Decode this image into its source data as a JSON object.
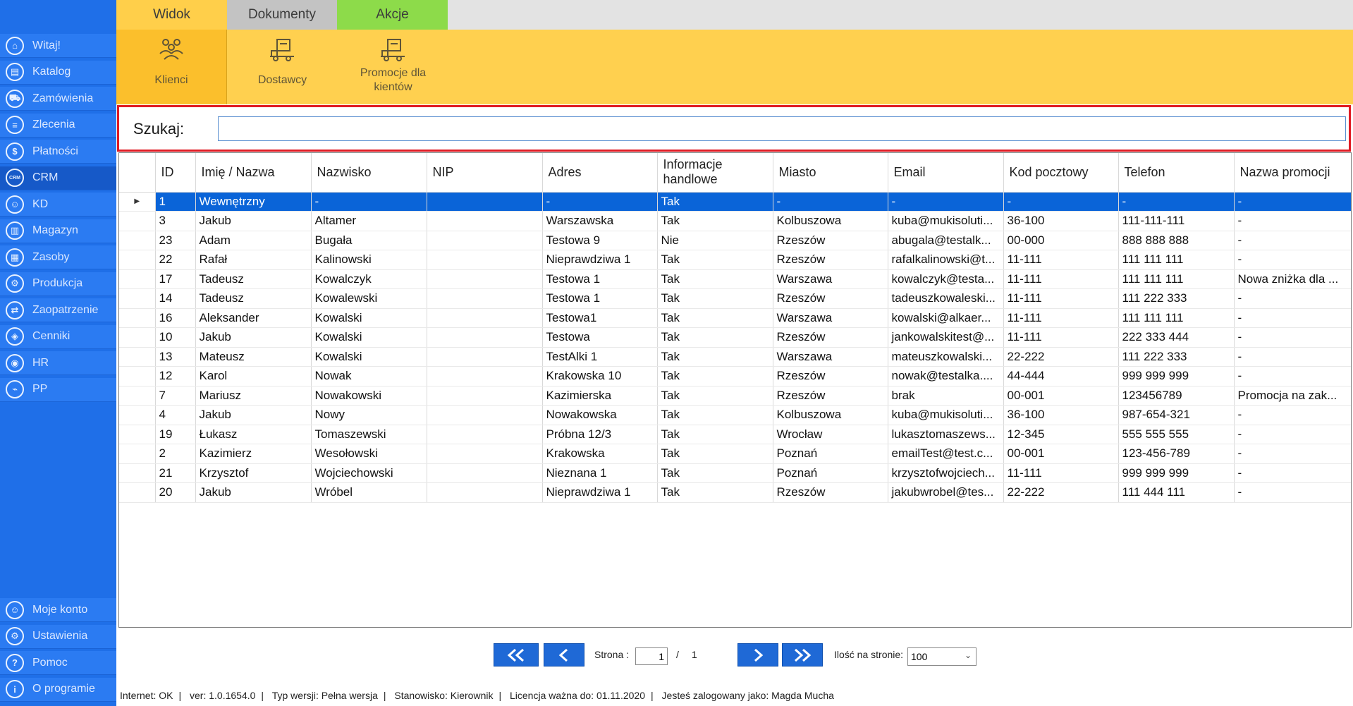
{
  "tabs": [
    "Widok",
    "Dokumenty",
    "Akcje"
  ],
  "ribbon": {
    "klienci": "Klienci",
    "dostawcy": "Dostawcy",
    "promocje_line1": "Promocje dla",
    "promocje_line2": "kientów"
  },
  "sidebar": {
    "items": [
      {
        "label": "Witaj!",
        "icon": "home-icon"
      },
      {
        "label": "Katalog",
        "icon": "book-icon"
      },
      {
        "label": "Zamówienia",
        "icon": "cart-icon"
      },
      {
        "label": "Zlecenia",
        "icon": "list-icon"
      },
      {
        "label": "Płatności",
        "icon": "dollar-icon"
      },
      {
        "label": "CRM",
        "icon": "crm-icon"
      },
      {
        "label": "KD",
        "icon": "person-icon"
      },
      {
        "label": "Magazyn",
        "icon": "warehouse-icon"
      },
      {
        "label": "Zasoby",
        "icon": "resources-icon"
      },
      {
        "label": "Produkcja",
        "icon": "production-icon"
      },
      {
        "label": "Zaopatrzenie",
        "icon": "truck-icon"
      },
      {
        "label": "Cenniki",
        "icon": "tag-icon"
      },
      {
        "label": "HR",
        "icon": "hr-icon"
      },
      {
        "label": "PP",
        "icon": "pp-icon"
      }
    ],
    "bottom": [
      {
        "label": "Moje konto",
        "icon": "account-icon"
      },
      {
        "label": "Ustawienia",
        "icon": "settings-icon"
      },
      {
        "label": "Pomoc",
        "icon": "help-icon"
      },
      {
        "label": "O programie",
        "icon": "info-icon"
      }
    ]
  },
  "search": {
    "label": "Szukaj:",
    "value": ""
  },
  "grid": {
    "columns": [
      "ID",
      "Imię / Nazwa",
      "Nazwisko",
      "NIP",
      "Adres",
      "Informacje handlowe",
      "Miasto",
      "Email",
      "Kod pocztowy",
      "Telefon",
      "Nazwa promocji"
    ],
    "rows": [
      [
        "1",
        "Wewnętrzny",
        "-",
        "",
        "-",
        "Tak",
        "-",
        "-",
        "-",
        "-",
        "-"
      ],
      [
        "3",
        "Jakub",
        "Altamer",
        "",
        "Warszawska",
        "Tak",
        "Kolbuszowa",
        "kuba@mukisoluti...",
        "36-100",
        "111-111-111",
        "-"
      ],
      [
        "23",
        "Adam",
        "Bugała",
        "",
        "Testowa 9",
        "Nie",
        "Rzeszów",
        "abugala@testalk...",
        "00-000",
        "888 888 888",
        "-"
      ],
      [
        "22",
        "Rafał",
        "Kalinowski",
        "",
        "Nieprawdziwa 1",
        "Tak",
        "Rzeszów",
        "rafalkalinowski@t...",
        "11-111",
        "111 111 111",
        "-"
      ],
      [
        "17",
        "Tadeusz",
        "Kowalczyk",
        "",
        "Testowa 1",
        "Tak",
        "Warszawa",
        "kowalczyk@testa...",
        "11-111",
        "111 111 111",
        "Nowa zniżka dla ..."
      ],
      [
        "14",
        "Tadeusz",
        "Kowalewski",
        "",
        "Testowa 1",
        "Tak",
        "Rzeszów",
        "tadeuszkowaleski...",
        "11-111",
        "111 222 333",
        "-"
      ],
      [
        "16",
        "Aleksander",
        "Kowalski",
        "",
        "Testowa1",
        "Tak",
        "Warszawa",
        "kowalski@alkaer...",
        "11-111",
        "111 111 111",
        "-"
      ],
      [
        "10",
        "Jakub",
        "Kowalski",
        "",
        "Testowa",
        "Tak",
        "Rzeszów",
        "jankowalskitest@...",
        "11-111",
        "222 333 444",
        "-"
      ],
      [
        "13",
        "Mateusz",
        "Kowalski",
        "",
        "TestAlki 1",
        "Tak",
        "Warszawa",
        "mateuszkowalski...",
        "22-222",
        "111 222 333",
        "-"
      ],
      [
        "12",
        "Karol",
        "Nowak",
        "",
        "Krakowska 10",
        "Tak",
        "Rzeszów",
        "nowak@testalka....",
        "44-444",
        "999 999 999",
        "-"
      ],
      [
        "7",
        "Mariusz",
        "Nowakowski",
        "",
        "Kazimierska",
        "Tak",
        "Rzeszów",
        "brak",
        "00-001",
        "123456789",
        "Promocja na zak..."
      ],
      [
        "4",
        "Jakub",
        "Nowy",
        "",
        "Nowakowska",
        "Tak",
        "Kolbuszowa",
        "kuba@mukisoluti...",
        "36-100",
        "987-654-321",
        "-"
      ],
      [
        "19",
        "Łukasz",
        "Tomaszewski",
        "",
        "Próbna 12/3",
        "Tak",
        "Wrocław",
        "lukasztomaszews...",
        "12-345",
        "555 555 555",
        "-"
      ],
      [
        "2",
        "Kazimierz",
        "Wesołowski",
        "",
        "Krakowska",
        "Tak",
        "Poznań",
        "emailTest@test.c...",
        "00-001",
        "123-456-789",
        "-"
      ],
      [
        "21",
        "Krzysztof",
        "Wojciechowski",
        "",
        "Nieznana 1",
        "Tak",
        "Poznań",
        "krzysztofwojciech...",
        "11-111",
        "999 999 999",
        "-"
      ],
      [
        "20",
        "Jakub",
        "Wróbel",
        "",
        "Nieprawdziwa 1",
        "Tak",
        "Rzeszów",
        "jakubwrobel@tes...",
        "22-222",
        "111 444 111",
        "-"
      ]
    ],
    "selected_row": 0
  },
  "pager": {
    "first": "<<",
    "prev": "<",
    "next": ">",
    "last": ">>",
    "page_label": "Strona :",
    "page_value": "1",
    "of": "/",
    "total_pages": "1",
    "per_page_label": "Ilość na stronie:",
    "per_page_value": "100"
  },
  "status": {
    "internet": "Internet: OK",
    "version": "ver: 1.0.1654.0",
    "type": "Typ wersji: Pełna wersja",
    "position": "Stanowisko: Kierownik",
    "license": "Licencja ważna do: 01.11.2020",
    "user": "Jesteś zalogowany jako: Magda Mucha"
  },
  "colors": {
    "sidebar": "#1f6fe8",
    "ribbon": "#ffd04f",
    "tab_widok": "#ffcf4a",
    "tab_dokumenty": "#c3c3c3",
    "tab_akcje": "#8ddb4a",
    "selection": "#0a64d8",
    "search_border": "#e01b24"
  }
}
